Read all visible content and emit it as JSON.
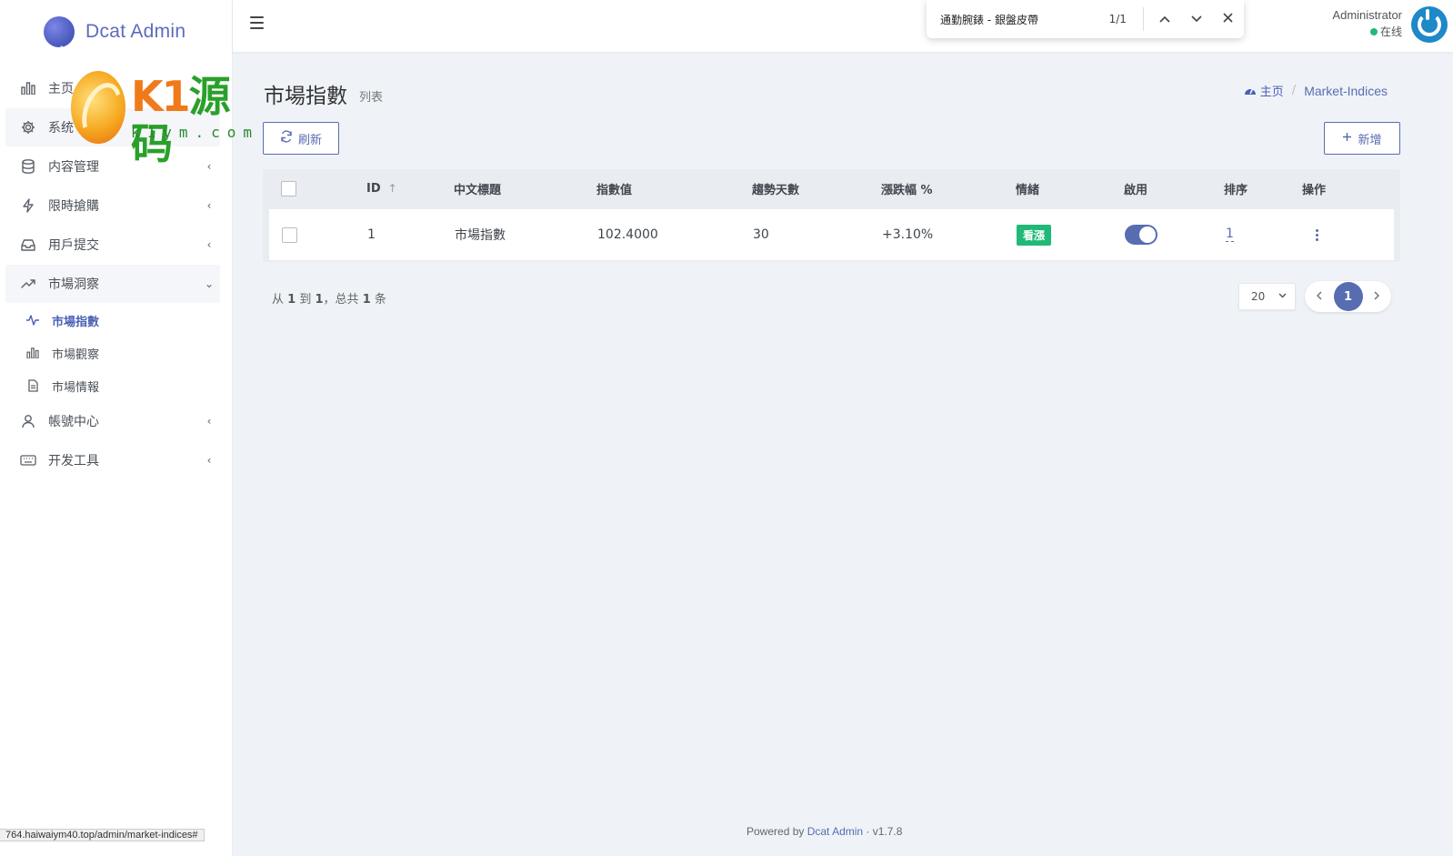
{
  "brand": {
    "name": "Dcat Admin"
  },
  "watermark": {
    "main": "K1",
    "main_green": "源码",
    "sub": "k1ym.com"
  },
  "sidebar": {
    "items": [
      {
        "label": "主页",
        "icon": "bar-chart-icon",
        "chevron": ""
      },
      {
        "label": "系统",
        "icon": "gear-icon",
        "chevron": ""
      },
      {
        "label": "内容管理",
        "icon": "database-icon",
        "chevron": "‹"
      },
      {
        "label": "限時搶購",
        "icon": "lightning-icon",
        "chevron": "‹"
      },
      {
        "label": "用戶提交",
        "icon": "inbox-icon",
        "chevron": "‹"
      },
      {
        "label": "市場洞察",
        "icon": "trend-icon",
        "chevron": "⌄"
      }
    ],
    "subitems": [
      {
        "label": "市場指數",
        "icon": "pulse-icon"
      },
      {
        "label": "市場觀察",
        "icon": "bar-chart-icon"
      },
      {
        "label": "市場情報",
        "icon": "document-icon"
      }
    ],
    "items_bottom": [
      {
        "label": "帳號中心",
        "icon": "user-icon",
        "chevron": "‹"
      },
      {
        "label": "开发工具",
        "icon": "keyboard-icon",
        "chevron": "‹"
      }
    ]
  },
  "findbar": {
    "query": "通勤腕錶 - 銀盤皮帶",
    "count": "1/1"
  },
  "user": {
    "name": "Administrator",
    "status": "在线"
  },
  "page": {
    "title": "市場指數",
    "subtitle": "列表"
  },
  "breadcrumb": {
    "home": "主页",
    "current": "Market-Indices"
  },
  "toolbar": {
    "refresh": "刷新",
    "add": "新增"
  },
  "table": {
    "headers": [
      "ID",
      "中文標題",
      "指數值",
      "趨勢天數",
      "漲跌幅 %",
      "情緒",
      "啟用",
      "排序",
      "操作"
    ],
    "rows": [
      {
        "id": "1",
        "title": "市場指數",
        "value": "102.4000",
        "days": "30",
        "change": "+3.10%",
        "sentiment": "看漲",
        "enabled": true,
        "order": "1"
      }
    ]
  },
  "pagination": {
    "summary_from": "从",
    "summary_start": "1",
    "summary_to": "到",
    "summary_end": "1",
    "summary_total_pre": "，总共",
    "summary_total": "1",
    "summary_unit": "条",
    "per_page": "20",
    "current_page": "1"
  },
  "footer": {
    "prefix": "Powered by",
    "link": "Dcat Admin",
    "version": "· v1.7.8"
  },
  "statusbar": {
    "url": "764.haiwaiym40.top/admin/market-indices#"
  },
  "colors": {
    "primary": "#586cb1",
    "success": "#21b978"
  }
}
